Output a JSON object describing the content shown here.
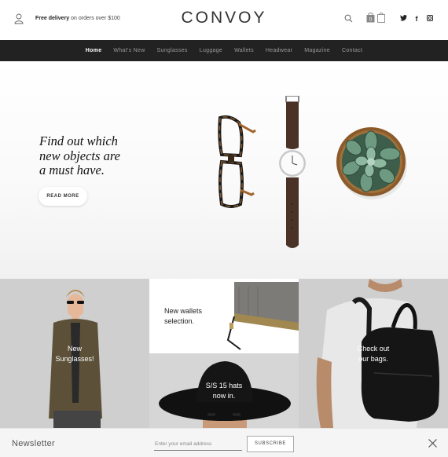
{
  "header": {
    "promo_bold": "Free delivery",
    "promo_rest": " on orders over $100",
    "logo": "CONVOY",
    "cart_count": "0",
    "social": [
      "t-icon",
      "f",
      "ig"
    ]
  },
  "nav": {
    "items": [
      "Home",
      "What's New",
      "Sunglasses",
      "Luggage",
      "Wallets",
      "Headwear",
      "Magazine",
      "Contact"
    ],
    "active": "Home"
  },
  "hero": {
    "title_lines": [
      "Find out which",
      "new objects are",
      "a must have."
    ],
    "button": "READ MORE"
  },
  "tiles": {
    "sunglasses": [
      "New",
      "Sunglasses!"
    ],
    "wallets": [
      "New wallets",
      "selection."
    ],
    "hats": [
      "S/S 15 hats",
      "now in."
    ],
    "bags": [
      "Check out",
      "our bags."
    ]
  },
  "newsletter": {
    "title": "Newsletter",
    "placeholder": "Enter your email address",
    "button": "SUBSCRIBE"
  },
  "colors": {
    "nav_bg": "#222222",
    "nav_active": "#ffffff",
    "nav_inactive": "#9a9a9a"
  }
}
